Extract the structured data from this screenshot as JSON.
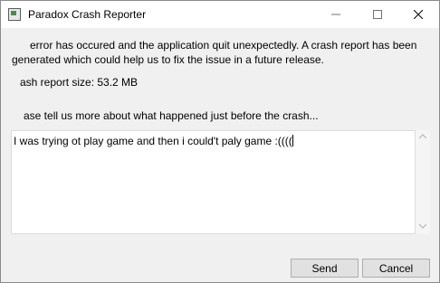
{
  "window": {
    "title": "Paradox Crash Reporter",
    "minimize_symbol": "–",
    "maximize_symbol": "□",
    "close_symbol": "✕"
  },
  "content": {
    "message": "error has occured and the application quit unexpectedly. A crash report has been generated which could help us to fix the issue in a future release.",
    "report_size": "ash report size: 53.2 MB",
    "prompt": "ase tell us more about what happened just before the crash..."
  },
  "description_field": {
    "value": "I was trying ot play game and then i could't paly game :(((("
  },
  "buttons": {
    "send_label": "Send",
    "cancel_label": "Cancel"
  },
  "icons": {
    "app": "app-window-icon",
    "scroll_up": "scroll-up-arrow-icon",
    "scroll_down": "scroll-down-arrow-icon"
  }
}
